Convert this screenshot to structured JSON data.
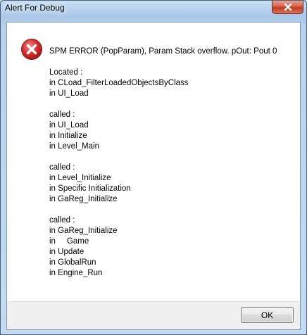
{
  "window": {
    "title": "Alert For Debug"
  },
  "dialog": {
    "icon": "error-icon",
    "heading": "SPM ERROR (PopParam), Param Stack overflow. pOut: Pout 0",
    "blocks": [
      [
        "Located :",
        "in CLoad_FilterLoadedObjectsByClass",
        "in UI_Load"
      ],
      [
        "called :",
        "in UI_Load",
        "in Initialize",
        "in Level_Main"
      ],
      [
        "called :",
        "in Level_Initialize",
        "in Specific Initialization",
        "in GaReg_Initialize"
      ],
      [
        "called :",
        "in GaReg_Initialize",
        "in     Game",
        "in Update",
        "in GlobalRun",
        "in Engine_Run"
      ]
    ],
    "ok_label": "OK"
  },
  "colors": {
    "error_red": "#d42c2c",
    "close_red": "#c03b22"
  }
}
